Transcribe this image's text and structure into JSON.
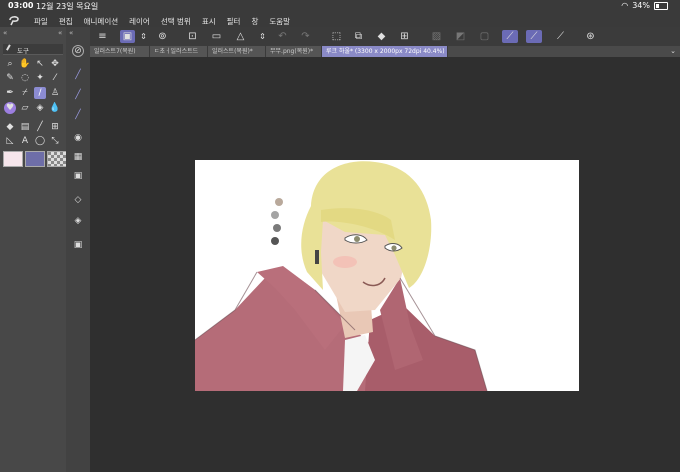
{
  "status": {
    "time": "03:00",
    "date": "12월 23일 목요일",
    "battery": "34%"
  },
  "menu": [
    "파일",
    "편집",
    "애니메이션",
    "레이어",
    "선택 범위",
    "표시",
    "필터",
    "창",
    "도움말"
  ],
  "tool_panel": {
    "label": "도구"
  },
  "tabs": [
    {
      "label": "일러스트7(복원)",
      "active": false
    },
    {
      "label": "ㄷ초ㅓ일러스트드",
      "active": false
    },
    {
      "label": "일러스트(복원)*",
      "active": false
    },
    {
      "label": "무무.png(복원)*",
      "active": false
    },
    {
      "label": "루크 하울* (3300 x 2000px 72dpi 40.4%)",
      "active": true
    }
  ],
  "colors": {
    "accent": "#8b8bd1",
    "main_color": "#f7e6ec",
    "sub_color": "#6e6ea8",
    "hair": "#e9e197",
    "coat": "#b56c78",
    "skin": "#f0d7c7"
  }
}
